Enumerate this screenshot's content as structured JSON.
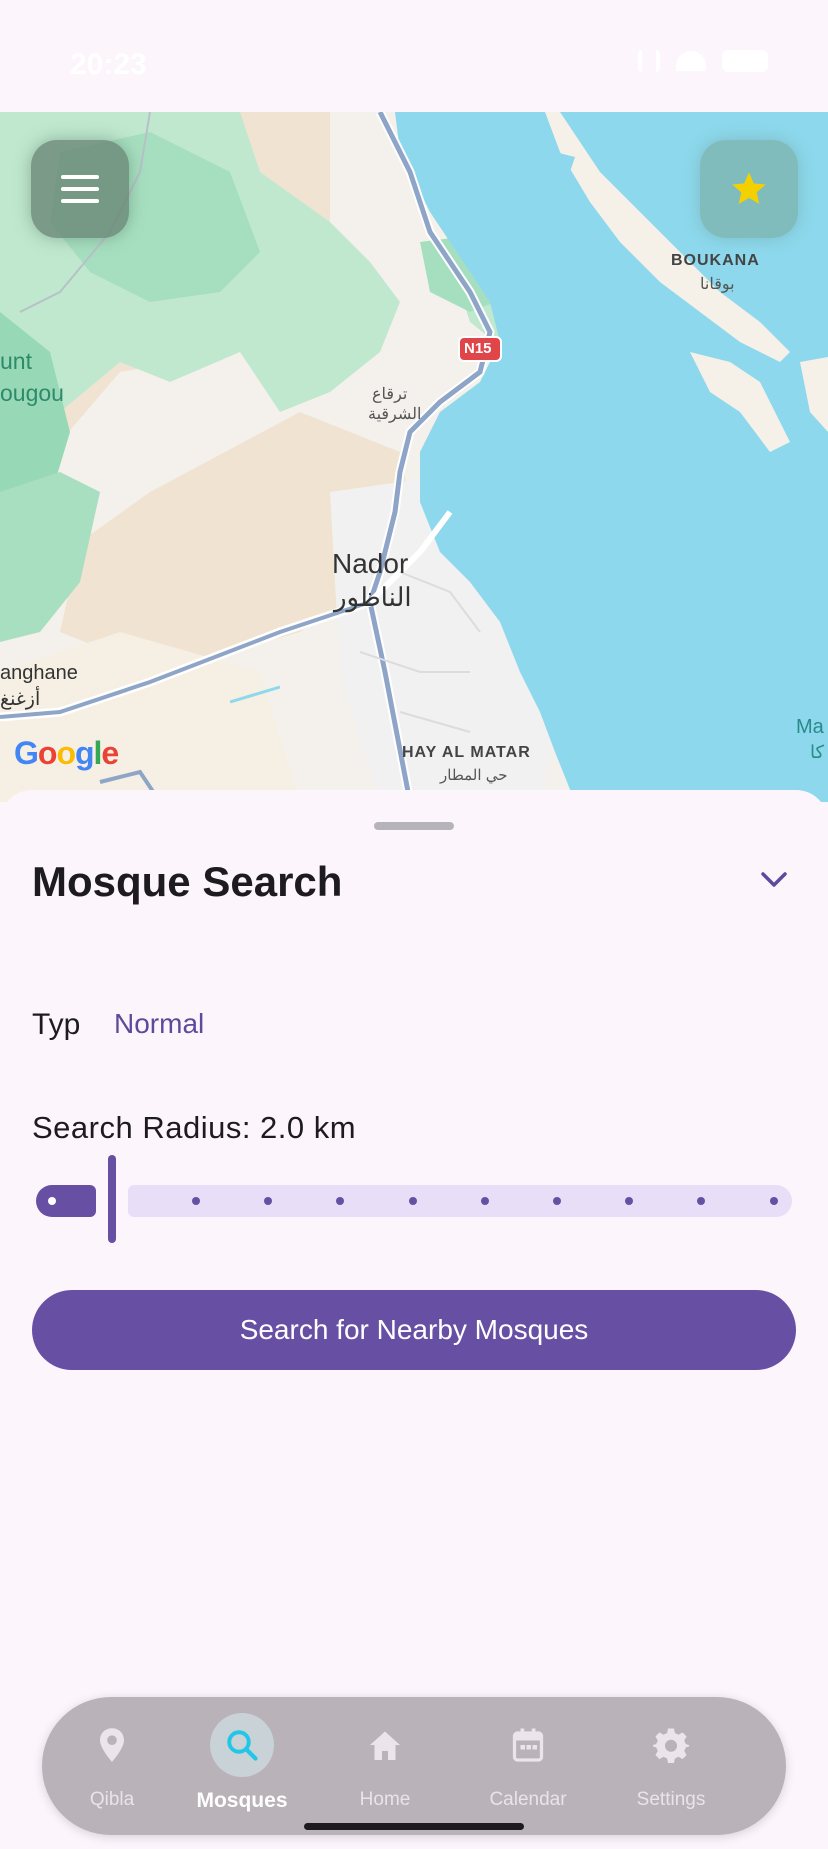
{
  "status_bar": {
    "time": "20:23",
    "icons": [
      "sim-icon",
      "wifi-icon",
      "battery-icon"
    ]
  },
  "map": {
    "labels": {
      "boukana": "BOUKANA",
      "boukana_ar": "بوقانا",
      "road": "N15",
      "tarquaa_ar": "ترقاع",
      "sharqia_ar": "الشرقية",
      "mount1": "unt",
      "mount2": "ougou",
      "nador": "Nador",
      "nador_ar": "الناظور",
      "azghanghane": "anghane",
      "azghanghane_ar": "أزغنغ",
      "hay_al_matar": "HAY AL MATAR",
      "hay_al_matar_ar": "حي المطار",
      "ma": "Ma",
      "ma_ar": "كا"
    },
    "attribution": "Google",
    "icons": {
      "menu": "menu-icon",
      "favorite": "star-icon"
    }
  },
  "sheet": {
    "title": "Mosque Search",
    "typ_label": "Typ",
    "typ_value": "Normal",
    "radius_label": "Search Radius: 2.0 km",
    "radius_value_km": 2.0,
    "search_button": "Search for Nearby Mosques"
  },
  "nav": {
    "items": [
      {
        "label": "Qibla",
        "icon": "location-pin-icon"
      },
      {
        "label": "Mosques",
        "icon": "search-icon",
        "active": true
      },
      {
        "label": "Home",
        "icon": "home-icon"
      },
      {
        "label": "Calendar",
        "icon": "calendar-icon"
      },
      {
        "label": "Settings",
        "icon": "gear-icon"
      }
    ]
  },
  "colors": {
    "primary": "#6750a4",
    "track": "#e8def8",
    "water": "#8dd8ec",
    "star": "#f5d000"
  }
}
